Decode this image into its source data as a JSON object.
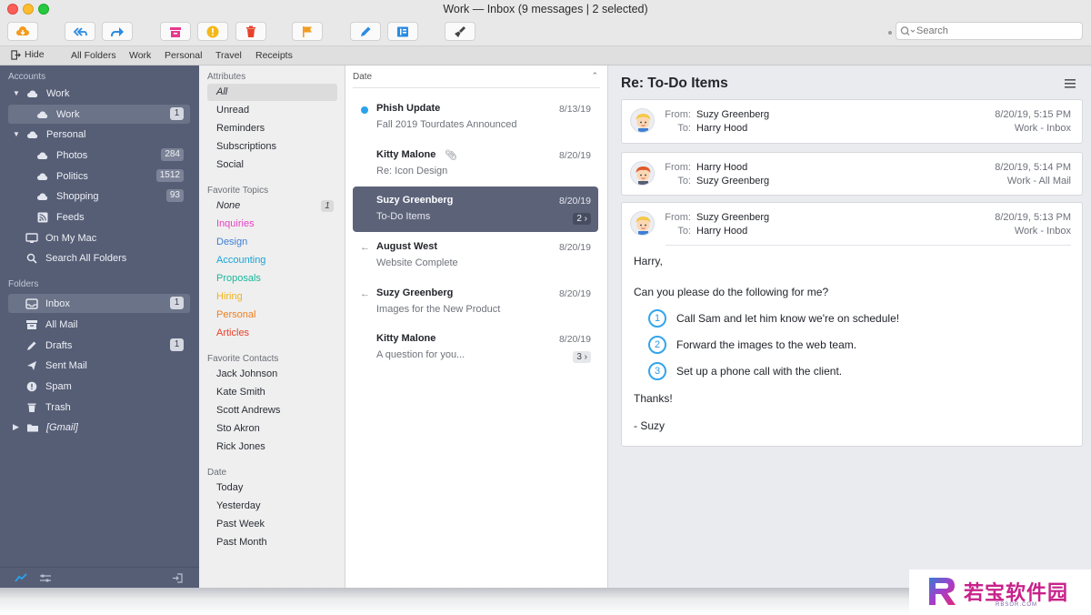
{
  "window": {
    "title": "Work — Inbox (9 messages | 2 selected)"
  },
  "toolbar": {
    "search_placeholder": "Search",
    "buttons": [
      "get-mail",
      "reply-all",
      "forward",
      "archive",
      "mark-spam",
      "delete",
      "flag",
      "compose",
      "contacts",
      "clean-up"
    ]
  },
  "favorites": {
    "hide_label": "Hide",
    "items": [
      "All Folders",
      "Work",
      "Personal",
      "Travel",
      "Receipts"
    ]
  },
  "sidebar": {
    "accounts_label": "Accounts",
    "accounts": [
      {
        "label": "Work",
        "icon": "cloud-icon",
        "expanded": true
      },
      {
        "label": "Work",
        "icon": "cloud-icon",
        "badge": "1",
        "selected": true
      },
      {
        "label": "Personal",
        "icon": "cloud-icon",
        "expanded": true
      },
      {
        "label": "Photos",
        "icon": "cloud-icon",
        "badge": "284"
      },
      {
        "label": "Politics",
        "icon": "cloud-icon",
        "badge": "1512"
      },
      {
        "label": "Shopping",
        "icon": "cloud-icon",
        "badge": "93"
      },
      {
        "label": "Feeds",
        "icon": "rss-icon"
      },
      {
        "label": "On My Mac",
        "icon": "computer-icon"
      },
      {
        "label": "Search All Folders",
        "icon": "search-icon"
      }
    ],
    "folders_label": "Folders",
    "folders": [
      {
        "label": "Inbox",
        "icon": "inbox-icon",
        "badge": "1",
        "selected": true
      },
      {
        "label": "All Mail",
        "icon": "archive-icon"
      },
      {
        "label": "Drafts",
        "icon": "pencil-icon",
        "badge": "1"
      },
      {
        "label": "Sent Mail",
        "icon": "send-icon"
      },
      {
        "label": "Spam",
        "icon": "spam-icon"
      },
      {
        "label": "Trash",
        "icon": "trash-icon"
      },
      {
        "label": "[Gmail]",
        "icon": "folder-icon"
      }
    ]
  },
  "attributes": {
    "attributes_label": "Attributes",
    "items": [
      "All",
      "Unread",
      "Reminders",
      "Subscriptions",
      "Social"
    ],
    "topics_label": "Favorite Topics",
    "topics": [
      {
        "label": "None",
        "color": "#2a2e35",
        "badge": "1"
      },
      {
        "label": "Inquiries",
        "color": "#e83fc4"
      },
      {
        "label": "Design",
        "color": "#3d7fd6"
      },
      {
        "label": "Accounting",
        "color": "#1aa3d6"
      },
      {
        "label": "Proposals",
        "color": "#1ab89a"
      },
      {
        "label": "Hiring",
        "color": "#f0b21c"
      },
      {
        "label": "Personal",
        "color": "#f07f1c"
      },
      {
        "label": "Articles",
        "color": "#e8412a"
      }
    ],
    "contacts_label": "Favorite Contacts",
    "contacts": [
      "Jack Johnson",
      "Kate Smith",
      "Scott Andrews",
      "Sto Akron",
      "Rick Jones"
    ],
    "date_label": "Date",
    "dates": [
      "Today",
      "Yesterday",
      "Past Week",
      "Past Month"
    ]
  },
  "message_list": {
    "sort_label": "Date",
    "messages": [
      {
        "sender": "Phish Update",
        "subject": "Fall 2019 Tourdates Announced",
        "date": "8/13/19",
        "unread": true
      },
      {
        "sender": "Kitty Malone",
        "subject": "Re: Icon Design",
        "date": "8/20/19",
        "attachment": true
      },
      {
        "sender": "Suzy Greenberg",
        "subject": "To-Do Items",
        "date": "8/20/19",
        "thread_count": "2",
        "selected": true
      },
      {
        "sender": "August West",
        "subject": "Website Complete",
        "date": "8/20/19",
        "replied": true
      },
      {
        "sender": "Suzy Greenberg",
        "subject": "Images for the New Product",
        "date": "8/20/19",
        "replied": true
      },
      {
        "sender": "Kitty Malone",
        "subject": "A question for you...",
        "date": "8/20/19",
        "thread_count": "3"
      }
    ]
  },
  "reader": {
    "title": "Re: To-Do Items",
    "from_label": "From:",
    "to_label": "To:",
    "messages": [
      {
        "from": "Suzy Greenberg",
        "to": "Harry Hood",
        "date": "8/20/19, 5:15 PM",
        "folder": "Work - Inbox",
        "avatar": "blonde"
      },
      {
        "from": "Harry Hood",
        "to": "Suzy Greenberg",
        "date": "8/20/19, 5:14 PM",
        "folder": "Work - All Mail",
        "avatar": "redhead"
      },
      {
        "from": "Suzy Greenberg",
        "to": "Harry Hood",
        "date": "8/20/19, 5:13 PM",
        "folder": "Work - Inbox",
        "avatar": "blonde"
      }
    ],
    "body": {
      "greeting": "Harry,",
      "intro": "Can you please do the following for me?",
      "steps": [
        {
          "num": "1",
          "text": "Call Sam and let him know we're on schedule!"
        },
        {
          "num": "2",
          "text": "Forward the images to the web team."
        },
        {
          "num": "3",
          "text": "Set up a phone call with the client."
        }
      ],
      "thanks": "Thanks!",
      "signature": "- Suzy"
    }
  },
  "watermark": {
    "text": "若宝软件园",
    "domain": "RBSOR.COM"
  },
  "colors": {
    "accent": "#2aa3ef",
    "sidebar": "#565e76",
    "selection": "#5c6379",
    "toolbar_orange": "#f39b1e",
    "toolbar_blue": "#2b8be3",
    "toolbar_pink": "#e8388f",
    "toolbar_yellow": "#f3b91b",
    "toolbar_red": "#e8412a"
  }
}
